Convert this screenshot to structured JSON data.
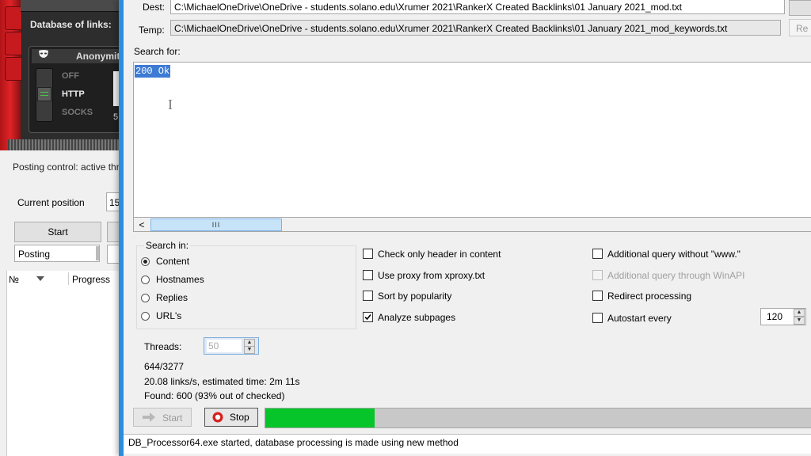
{
  "background_window": {
    "database_label": "Database of links:",
    "anonymity_label": "Anonymity",
    "options": [
      "OFF",
      "HTTP",
      "SOCKS"
    ],
    "selected_option": "HTTP",
    "side_value": "5",
    "posting_control": "Posting control: active thre",
    "current_position_label": "Current position",
    "current_position_value": "15",
    "start_label": "Start",
    "posting_status": "Posting",
    "columns": [
      "№",
      "Progress"
    ]
  },
  "dialog": {
    "dest_label": "Dest:",
    "dest_value": "C:\\MichaelOneDrive\\OneDrive - students.solano.edu\\Xrumer 2021\\RankerX Created Backlinks\\01 January 2021_mod.txt",
    "temp_label": "Temp:",
    "temp_value": "C:\\MichaelOneDrive\\OneDrive - students.solano.edu\\Xrumer 2021\\RankerX Created Backlinks\\01 January 2021_mod_keywords.txt",
    "side_button_label": "Re",
    "search_for_label": "Search for:",
    "search_text": "200 Ok",
    "scroll_thumb_grip": "III",
    "search_in": {
      "label": "Search in:",
      "options": [
        "Content",
        "Hostnames",
        "Replies",
        "URL's"
      ],
      "selected": "Content"
    },
    "checkboxes_col1": [
      {
        "label": "Check only header in content",
        "checked": false
      },
      {
        "label": "Use proxy from xproxy.txt",
        "checked": false
      },
      {
        "label": "Sort by popularity",
        "checked": false
      },
      {
        "label": "Analyze subpages",
        "checked": true
      }
    ],
    "checkboxes_col2": [
      {
        "label": "Additional query without \"www.\"",
        "checked": false,
        "disabled": false
      },
      {
        "label": "Additional query through WinAPI",
        "checked": false,
        "disabled": true
      },
      {
        "label": "Redirect processing",
        "checked": false,
        "disabled": false
      },
      {
        "label": "Autostart every",
        "checked": false,
        "disabled": false
      }
    ],
    "autostart_value": "120",
    "threads_label": "Threads:",
    "threads_value": "50",
    "progress_count": "644/3277",
    "speed_text": "20.08 links/s, estimated time: 2m 11s",
    "found_text": "Found: 600 (93% out of checked)",
    "start_label": "Start",
    "stop_label": "Stop",
    "progress_fraction": 0.2,
    "status_text": "DB_Processor64.exe started, database processing is made using new method"
  },
  "colors": {
    "accent_blue": "#2a8de0",
    "selection": "#3d7bd5",
    "progress_green": "#06c52a",
    "brand_red": "#e02428"
  },
  "icons": [
    "mask-icon",
    "arrow-right-icon",
    "stop-icon",
    "checkmark-icon"
  ]
}
